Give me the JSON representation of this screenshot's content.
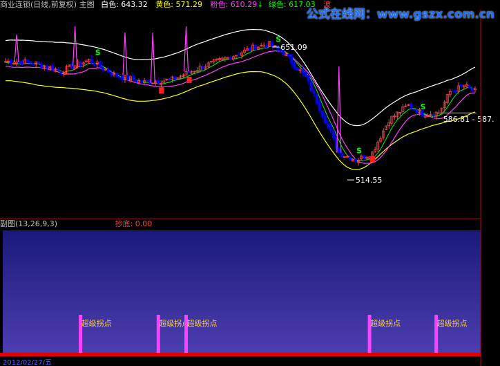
{
  "header": {
    "title": "商业连锁(日线,前复权) 主图",
    "items": [
      {
        "label": "白色",
        "value": "643.32",
        "color": "#ffffff"
      },
      {
        "label": "黄色",
        "value": "571.29",
        "color": "#ffff00"
      },
      {
        "label": "粉色",
        "value": "610.29",
        "color": "#ff40ff"
      },
      {
        "label": "绿色",
        "value": "617.03",
        "color": "#00ff00"
      },
      {
        "label": "波",
        "value": "",
        "color": "#ff4040"
      }
    ],
    "arrow_symbol": "↓"
  },
  "watermark": "公式在线网：www.gszx.com.cn",
  "subchart": {
    "title": "副图(13,26,9,3)",
    "indicator_label": "抄底",
    "indicator_value": "0.00"
  },
  "chart_data": {
    "type": "candlestick",
    "annotations": {
      "high_label": "651.09",
      "low_label": "514.55",
      "range_label": "586.81 - 587."
    },
    "signal_label": "超级拐点",
    "signal_bars": [
      27,
      55,
      65,
      131,
      155
    ],
    "s_marks": [
      33,
      98,
      127,
      150
    ],
    "b_marks": [
      56,
      66,
      132
    ],
    "spike_bars": [
      4,
      25,
      43,
      53,
      65,
      120
    ],
    "date_label": "2012/02/27/五",
    "colors": {
      "up": "#ff4040",
      "down": "#0000ff",
      "upper_band": "#ffffff",
      "lower_band": "#ffff00",
      "pink_line": "#ff40ff",
      "green_line": "#00ff00",
      "axis": "#c00000",
      "sub_bg_top": "#1a1a7a",
      "sub_bg_bottom": "#4e3eb0",
      "signal": "#ff40ff"
    }
  }
}
